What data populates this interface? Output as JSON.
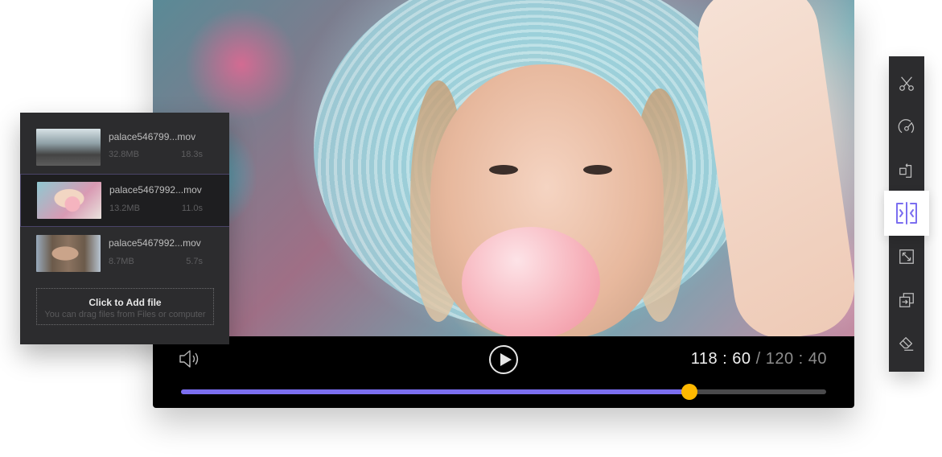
{
  "player": {
    "current_time": "118 : 60",
    "total_time": "/ 120 : 40",
    "progress_fraction": 0.788,
    "colors": {
      "progress_fill": "#7b6ef0",
      "progress_knob": "#ffb800",
      "progress_track": "#4a4a4c"
    },
    "icons": {
      "volume": "speaker-volume-icon",
      "play": "play-circle-icon"
    }
  },
  "file_list": {
    "items": [
      {
        "name": "palace546799...mov",
        "size": "32.8MB",
        "duration": "18.3s",
        "selected": false
      },
      {
        "name": "palace5467992...mov",
        "size": "13.2MB",
        "duration": "11.0s",
        "selected": true
      },
      {
        "name": "palace5467992...mov",
        "size": "8.7MB",
        "duration": "5.7s",
        "selected": false
      }
    ],
    "add_file": {
      "title": "Click to Add file",
      "subtitle": "You can drag files from Files or computer"
    }
  },
  "toolbar": {
    "accent": "#7b6ef0",
    "tools": [
      {
        "icon": "scissors-icon",
        "label": "Cut"
      },
      {
        "icon": "speedometer-icon",
        "label": "Speed"
      },
      {
        "icon": "rotate-icon",
        "label": "Rotate"
      },
      {
        "icon": "split-icon",
        "label": "Split",
        "active": true
      },
      {
        "icon": "resize-icon",
        "label": "Resize"
      },
      {
        "icon": "merge-icon",
        "label": "Merge"
      },
      {
        "icon": "eraser-icon",
        "label": "Erase"
      }
    ]
  }
}
